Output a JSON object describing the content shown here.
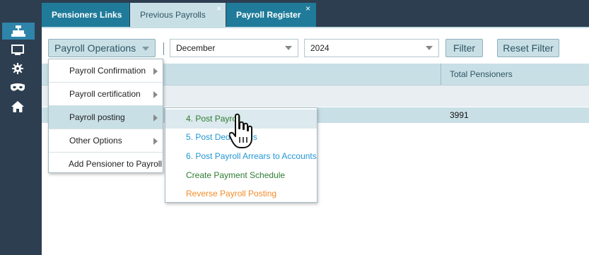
{
  "tabs": [
    {
      "label": "Pensioners Links",
      "closable": false
    },
    {
      "label": "Previous Payrolls",
      "closable": true,
      "active": true
    },
    {
      "label": "Payroll Register",
      "closable": true
    }
  ],
  "tab_close_glyph": "×",
  "toolbar": {
    "operations_label": "Payroll Operations",
    "month_value": "December",
    "year_value": "2024",
    "filter_label": "Filter",
    "reset_label": "Reset Filter"
  },
  "grid": {
    "columns": [
      "",
      "Total Pensioners"
    ],
    "rows": [
      {
        "total_pensioners": "3991"
      }
    ]
  },
  "menu": {
    "items": [
      {
        "label": "Payroll Confirmation",
        "has_submenu": true
      },
      {
        "label": "Payroll certification",
        "has_submenu": true
      },
      {
        "label": "Payroll posting",
        "has_submenu": true,
        "highlighted": true
      },
      {
        "label": "Other Options",
        "has_submenu": true
      },
      {
        "label": "Add Pensioner to Payroll",
        "has_submenu": false
      }
    ]
  },
  "submenu": {
    "items": [
      {
        "label": "4. Post Payroll",
        "color": "#2e7d32"
      },
      {
        "label": "5. Post Deductions",
        "color": "#2196d6"
      },
      {
        "label": "6. Post Payroll Arrears to Accounts",
        "color": "#2196d6"
      },
      {
        "label": "Create Payment Schedule",
        "color": "#2e7d32"
      },
      {
        "label": "Reverse Payroll Posting",
        "color": "#f28c28"
      }
    ]
  },
  "sidebar": {
    "icons": [
      "hamburger-icon",
      "cashier-icon",
      "monitor-icon",
      "gear-icon",
      "mask-icon",
      "home-icon"
    ]
  },
  "colors": {
    "rail": "#2d3e50",
    "tab_active": "#1f7b99",
    "light_blue": "#c9dfe6"
  }
}
